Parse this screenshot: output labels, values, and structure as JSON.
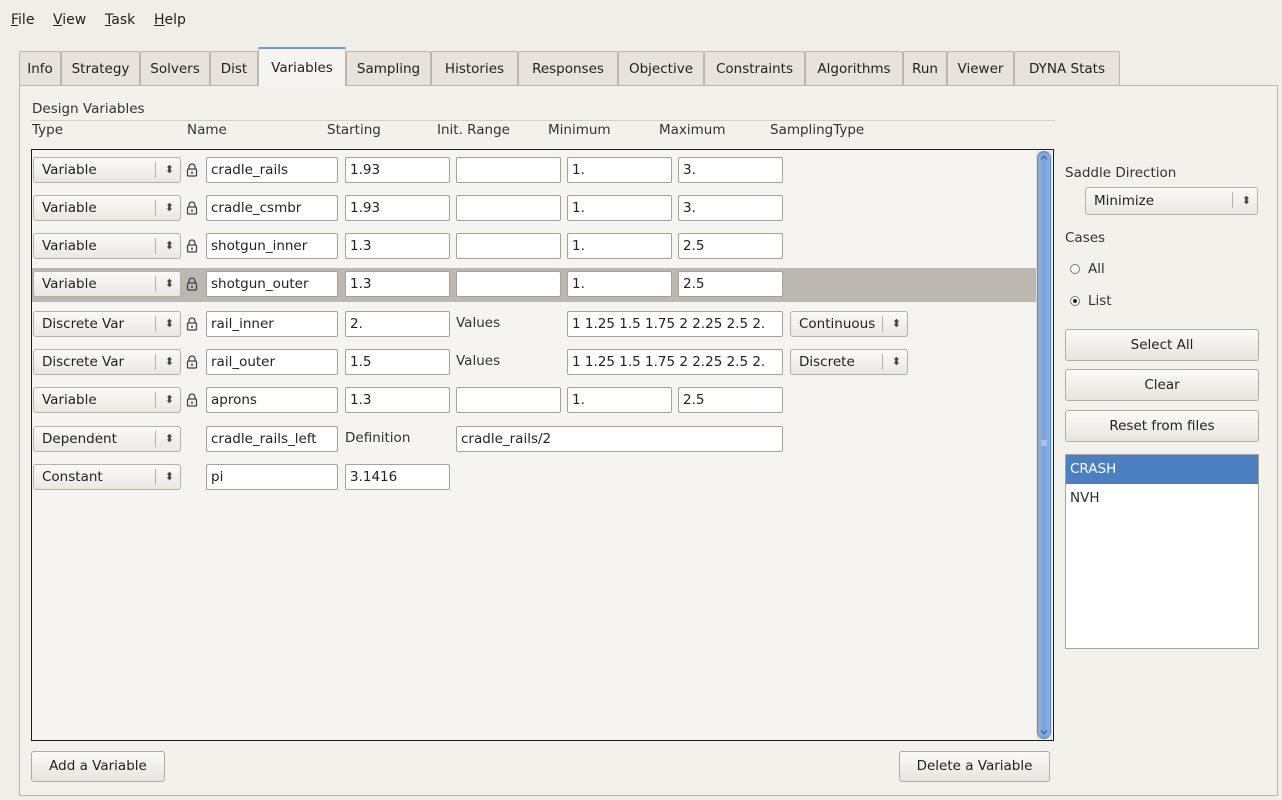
{
  "menu": [
    {
      "mn": "F",
      "rest": "ile"
    },
    {
      "mn": "V",
      "rest": "iew"
    },
    {
      "mn": "T",
      "rest": "ask"
    },
    {
      "mn": "H",
      "rest": "elp"
    }
  ],
  "tabs": [
    "Info",
    "Strategy",
    "Solvers",
    "Dist",
    "Variables",
    "Sampling",
    "Histories",
    "Responses",
    "Objective",
    "Constraints",
    "Algorithms",
    "Run",
    "Viewer",
    "DYNA Stats"
  ],
  "active_tab": "Variables",
  "design_variables_label": "Design Variables",
  "columns": {
    "type": "Type",
    "name": "Name",
    "starting": "Starting",
    "init_range": "Init. Range",
    "minimum": "Minimum",
    "maximum": "Maximum",
    "sampling_type": "SamplingType"
  },
  "rows": [
    {
      "type": "Variable",
      "name": "cradle_rails",
      "starting": "1.93",
      "init_range": "",
      "minimum": "1.",
      "maximum": "3."
    },
    {
      "type": "Variable",
      "name": "cradle_csmbr",
      "starting": "1.93",
      "init_range": "",
      "minimum": "1.",
      "maximum": "3."
    },
    {
      "type": "Variable",
      "name": "shotgun_inner",
      "starting": "1.3",
      "init_range": "",
      "minimum": "1.",
      "maximum": "2.5"
    },
    {
      "type": "Variable",
      "name": "shotgun_outer",
      "starting": "1.3",
      "init_range": "",
      "minimum": "1.",
      "maximum": "2.5"
    },
    {
      "type": "Discrete Var",
      "name": "rail_inner",
      "starting": "2.",
      "values_label": "Values",
      "values": "1 1.25 1.5 1.75 2 2.25 2.5 2.",
      "sampling": "Continuous"
    },
    {
      "type": "Discrete Var",
      "name": "rail_outer",
      "starting": "1.5",
      "values_label": "Values",
      "values": "1 1.25 1.5 1.75 2 2.25 2.5 2.",
      "sampling": "Discrete"
    },
    {
      "type": "Variable",
      "name": "aprons",
      "starting": "1.3",
      "init_range": "",
      "minimum": "1.",
      "maximum": "2.5"
    },
    {
      "type": "Dependent",
      "name": "cradle_rails_left",
      "definition_label": "Definition",
      "definition": "cradle_rails/2"
    },
    {
      "type": "Constant",
      "name": "pi",
      "starting": "3.1416"
    }
  ],
  "buttons": {
    "add_variable": "Add a Variable",
    "delete_variable": "Delete a Variable"
  },
  "sidebar": {
    "saddle_label": "Saddle Direction",
    "saddle_value": "Minimize",
    "cases_label": "Cases",
    "radio_all": "All",
    "radio_list": "List",
    "select_all": "Select All",
    "clear": "Clear",
    "reset_from_files": "Reset from files",
    "cases": [
      "CRASH",
      "NVH"
    ],
    "selected_case": "CRASH"
  }
}
